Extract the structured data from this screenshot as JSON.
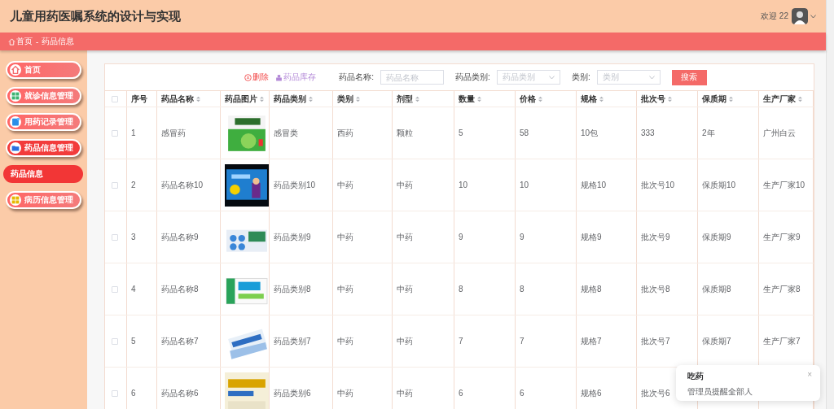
{
  "header": {
    "title": "儿童用药医嘱系统的设计与实现",
    "welcome": "欢迎 22"
  },
  "breadcrumb": [
    "首页",
    "-",
    "药品信息"
  ],
  "sidebar": {
    "items": [
      {
        "label": "首页",
        "selected": false
      },
      {
        "label": "就诊信息管理",
        "selected": false
      },
      {
        "label": "用药记录管理",
        "selected": false
      },
      {
        "label": "药品信息管理",
        "selected": true,
        "children": [
          {
            "label": "药品信息",
            "selected": true
          }
        ]
      },
      {
        "label": "病历信息管理",
        "selected": false
      }
    ]
  },
  "toolbar": {
    "delete": "删除",
    "stock": "药品库存",
    "filters": [
      {
        "kind": "input",
        "label": "药品名称:",
        "placeholder": "药品名称"
      },
      {
        "kind": "select",
        "label": "药品类别:",
        "placeholder": "药品类别"
      },
      {
        "kind": "select",
        "label": "类别:",
        "placeholder": "类别"
      }
    ],
    "search": "搜索"
  },
  "table": {
    "all_checked": false,
    "columns": [
      {
        "label": "序号",
        "sortable": false
      },
      {
        "label": "药品名称",
        "sortable": true
      },
      {
        "label": "药品图片",
        "sortable": true
      },
      {
        "label": "药品类别",
        "sortable": true
      },
      {
        "label": "类别",
        "sortable": true
      },
      {
        "label": "剂型",
        "sortable": true
      },
      {
        "label": "数量",
        "sortable": true
      },
      {
        "label": "价格",
        "sortable": true
      },
      {
        "label": "规格",
        "sortable": true
      },
      {
        "label": "批次号",
        "sortable": true
      },
      {
        "label": "保质期",
        "sortable": true
      },
      {
        "label": "生产厂家",
        "sortable": true
      }
    ],
    "rows": [
      {
        "checked": false,
        "cells": [
          "1",
          "感冒药",
          null,
          "感冒类",
          "西药",
          "颗粒",
          "5",
          "58",
          "10包",
          "333",
          "2年",
          "广州白云"
        ]
      },
      {
        "checked": false,
        "cells": [
          "2",
          "药品名称10",
          null,
          "药品类别10",
          "中药",
          "中药",
          "10",
          "10",
          "规格10",
          "批次号10",
          "保质期10",
          "生产厂家10"
        ]
      },
      {
        "checked": false,
        "cells": [
          "3",
          "药品名称9",
          null,
          "药品类别9",
          "中药",
          "中药",
          "9",
          "9",
          "规格9",
          "批次号9",
          "保质期9",
          "生产厂家9"
        ]
      },
      {
        "checked": false,
        "cells": [
          "4",
          "药品名称8",
          null,
          "药品类别8",
          "中药",
          "中药",
          "8",
          "8",
          "规格8",
          "批次号8",
          "保质期8",
          "生产厂家8"
        ]
      },
      {
        "checked": false,
        "cells": [
          "5",
          "药品名称7",
          null,
          "药品类别7",
          "中药",
          "中药",
          "7",
          "7",
          "规格7",
          "批次号7",
          "保质期7",
          "生产厂家7"
        ]
      },
      {
        "checked": false,
        "cells": [
          "6",
          "药品名称6",
          null,
          "药品类别6",
          "中药",
          "中药",
          "6",
          "6",
          "规格6",
          "批次号6",
          null,
          null
        ]
      }
    ]
  },
  "notification": {
    "title": "吃药",
    "message": "管理员提醒全部人",
    "close": "×"
  }
}
